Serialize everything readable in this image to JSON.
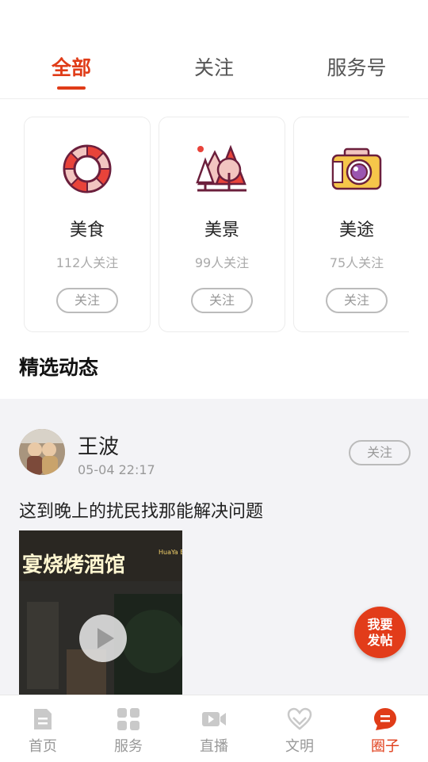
{
  "tabs": [
    {
      "label": "全部",
      "active": true
    },
    {
      "label": "关注",
      "active": false
    },
    {
      "label": "服务号",
      "active": false
    }
  ],
  "categories": [
    {
      "name": "美食",
      "count": "112人关注",
      "follow": "关注",
      "icon": "lifebuoy-icon"
    },
    {
      "name": "美景",
      "count": "99人关注",
      "follow": "关注",
      "icon": "mountain-tree-icon"
    },
    {
      "name": "美途",
      "count": "75人关注",
      "follow": "关注",
      "icon": "camera-icon"
    }
  ],
  "section_title": "精选动态",
  "post": {
    "user": "王波",
    "time": "05-04 22:17",
    "follow": "关注",
    "text": "这到晚上的扰民找那能解决问题",
    "video_sign": "宴烧烤酒馆",
    "video_sign_sub": "HuaYa Barbe"
  },
  "fab": {
    "line1": "我要",
    "line2": "发帖"
  },
  "bottom_nav": [
    {
      "label": "首页",
      "icon": "home-doc-icon",
      "active": false
    },
    {
      "label": "服务",
      "icon": "grid-icon",
      "active": false
    },
    {
      "label": "直播",
      "icon": "video-camera-icon",
      "active": false
    },
    {
      "label": "文明",
      "icon": "heart-hands-icon",
      "active": false
    },
    {
      "label": "圈子",
      "icon": "chat-bubble-icon",
      "active": true
    }
  ],
  "colors": {
    "accent": "#e03c18",
    "icon_dark": "#6b1f3c",
    "icon_light_pink": "#f2c5c0"
  }
}
